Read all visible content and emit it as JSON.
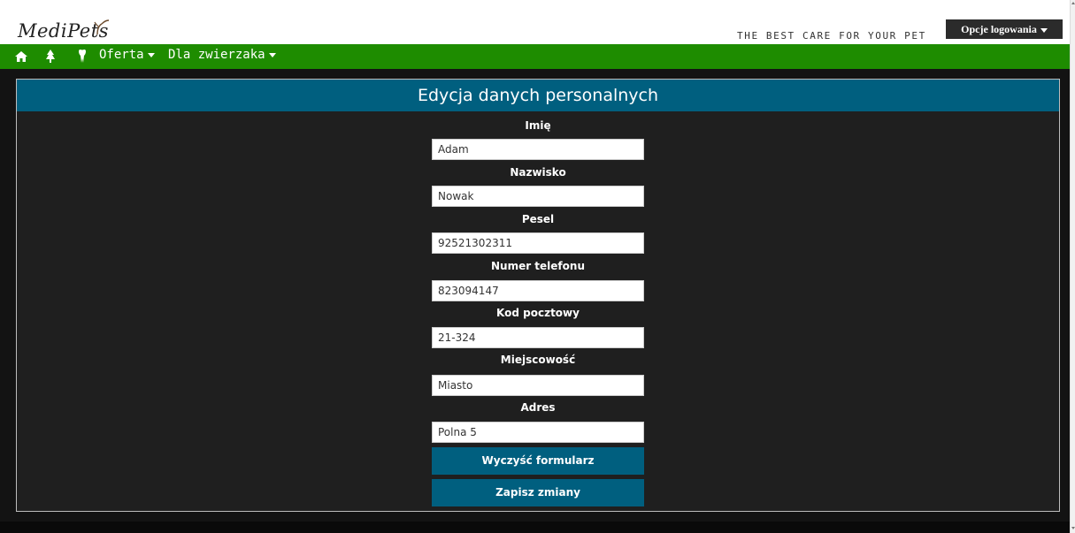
{
  "header": {
    "logo_text": "MediPets",
    "tagline": "THE BEST CARE FOR YOUR PET",
    "login_button_label": "Opcje logowania"
  },
  "nav": {
    "icons": [
      "home-icon",
      "tree-icon",
      "tooth-icon"
    ],
    "items": [
      {
        "label": "Oferta"
      },
      {
        "label": "Dla zwierzaka"
      }
    ]
  },
  "form": {
    "title": "Edycja danych personalnych",
    "fields": [
      {
        "label": "Imię",
        "value": "Adam"
      },
      {
        "label": "Nazwisko",
        "value": "Nowak"
      },
      {
        "label": "Pesel",
        "value": "92521302311"
      },
      {
        "label": "Numer telefonu",
        "value": "823094147"
      },
      {
        "label": "Kod pocztowy",
        "value": "21-324"
      },
      {
        "label": "Miejscowość",
        "value": "Miasto"
      },
      {
        "label": "Adres",
        "value": "Polna 5"
      }
    ],
    "clear_button_label": "Wyczyść formularz",
    "save_button_label": "Zapisz zmiany"
  },
  "colors": {
    "nav_green": "#1e8c00",
    "accent_blue": "#005f7f",
    "background_dark": "#131313"
  }
}
